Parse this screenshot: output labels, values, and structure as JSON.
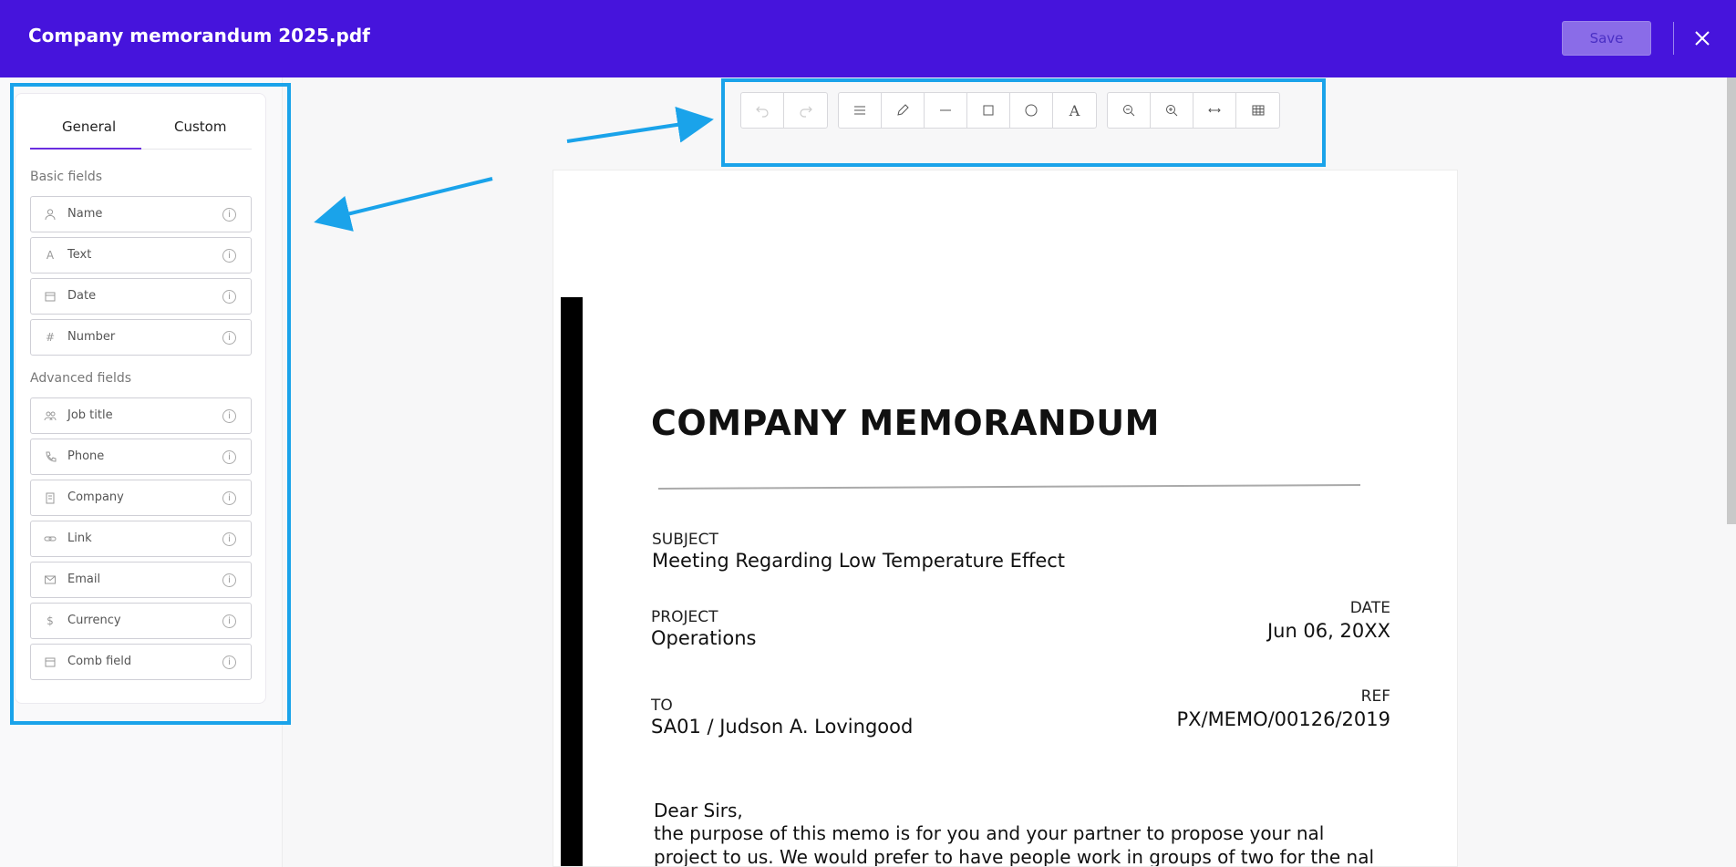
{
  "header": {
    "title": "Company memorandum 2025.pdf",
    "save_label": "Save"
  },
  "sidebar": {
    "tabs": [
      {
        "label": "General",
        "active": true
      },
      {
        "label": "Custom",
        "active": false
      }
    ],
    "basic_label": "Basic fields",
    "basic_fields": [
      {
        "label": "Name",
        "icon": "user-icon"
      },
      {
        "label": "Text",
        "icon": "text-icon"
      },
      {
        "label": "Date",
        "icon": "calendar-icon"
      },
      {
        "label": "Number",
        "icon": "hash-icon"
      }
    ],
    "advanced_label": "Advanced fields",
    "advanced_fields": [
      {
        "label": "Job title",
        "icon": "people-icon"
      },
      {
        "label": "Phone",
        "icon": "phone-icon"
      },
      {
        "label": "Company",
        "icon": "building-icon"
      },
      {
        "label": "Link",
        "icon": "link-icon"
      },
      {
        "label": "Email",
        "icon": "envelope-icon"
      },
      {
        "label": "Currency",
        "icon": "dollar-icon"
      },
      {
        "label": "Comb field",
        "icon": "calendar-icon"
      }
    ]
  },
  "toolbar": {
    "history": [
      "undo-icon",
      "redo-icon"
    ],
    "draw": [
      "menu-icon",
      "pencil-icon",
      "line-icon",
      "square-icon",
      "circle-icon",
      "text-tool-icon"
    ],
    "view": [
      "zoom-out-icon",
      "zoom-in-icon",
      "fit-width-icon",
      "grid-icon"
    ]
  },
  "document": {
    "heading": "COMPANY MEMORANDUM",
    "subject_label": "SUBJECT",
    "subject_value": "Meeting Regarding Low Temperature Effect",
    "project_label": "PROJECT",
    "project_value": "Operations",
    "date_label": "DATE",
    "date_value": "Jun 06, 20XX",
    "to_label": "TO",
    "to_value": "SA01 / Judson A. Lovingood",
    "ref_label": "REF",
    "ref_value": "PX/MEMO/00126/2019",
    "greeting": "Dear Sirs,",
    "body_line_1": "the purpose of this memo is for you and your partner to propose your nal",
    "body_line_2": "project to us. We would prefer to have people work in groups of two for the nal"
  },
  "colors": {
    "header_bg": "#4614dc",
    "highlight": "#1aa3ea",
    "tab_accent": "#6a2ee0"
  }
}
